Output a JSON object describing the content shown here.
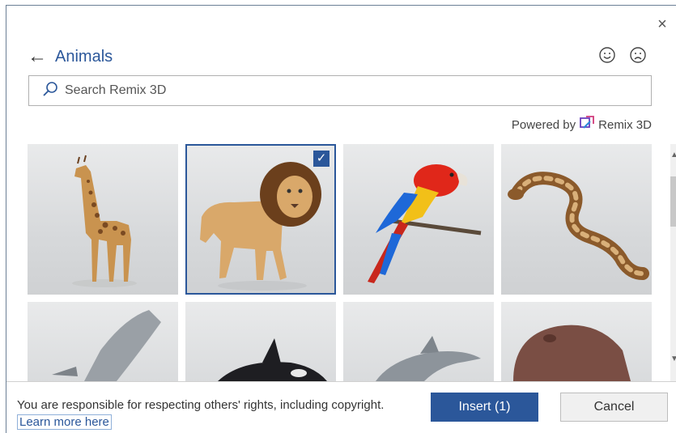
{
  "dialog": {
    "close_glyph": "×",
    "back_glyph": "←",
    "title": "Animals",
    "feedback": {
      "positive_icon": "smiley-face-icon",
      "negative_icon": "frowny-face-icon"
    }
  },
  "search": {
    "value": "",
    "placeholder": "Search Remix 3D",
    "icon": "search-icon"
  },
  "powered_by": {
    "prefix": "Powered by",
    "brand": "Remix 3D",
    "brand_icon": "remix-3d-logo-icon"
  },
  "gallery": {
    "items": [
      {
        "name": "giraffe",
        "selected": false
      },
      {
        "name": "lion",
        "selected": true
      },
      {
        "name": "parrot",
        "selected": false
      },
      {
        "name": "snake",
        "selected": false
      },
      {
        "name": "shark",
        "selected": false
      },
      {
        "name": "orca",
        "selected": false
      },
      {
        "name": "dolphin",
        "selected": false
      },
      {
        "name": "hippo",
        "selected": false
      }
    ],
    "check_glyph": "✓"
  },
  "footer": {
    "notice_text": "You are responsible for respecting others' rights, including copyright.",
    "learn_more": "Learn more here",
    "insert_label": "Insert (1)",
    "cancel_label": "Cancel"
  },
  "colors": {
    "accent": "#2b579a",
    "tile_bg": "#dcdedf"
  }
}
